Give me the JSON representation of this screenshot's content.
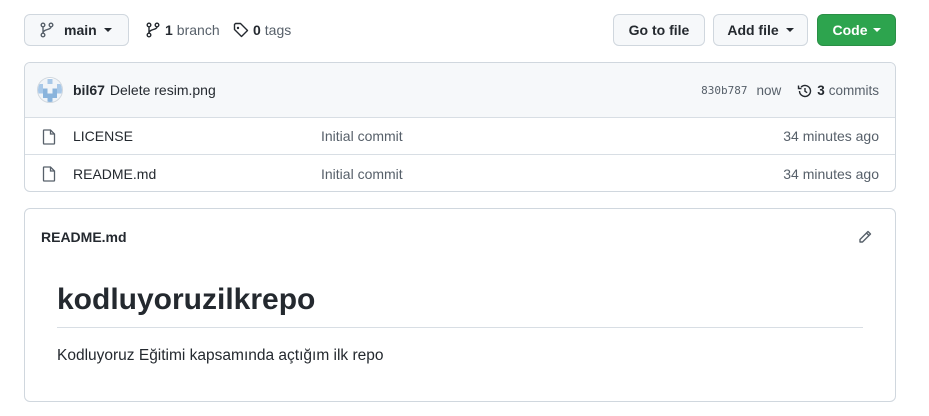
{
  "toolbar": {
    "branch_name": "main",
    "branch_count": "1",
    "branch_label": "branch",
    "tag_count": "0",
    "tag_label": "tags",
    "go_to_file": "Go to file",
    "add_file": "Add file",
    "code": "Code"
  },
  "commit": {
    "author": "bil67",
    "message": "Delete resim.png",
    "sha": "830b787",
    "time": "now",
    "commit_count": "3",
    "commit_label": "commits"
  },
  "files": [
    {
      "name": "LICENSE",
      "message": "Initial commit",
      "age": "34 minutes ago",
      "icon": "file-icon"
    },
    {
      "name": "README.md",
      "message": "Initial commit",
      "age": "34 minutes ago",
      "icon": "file-icon"
    }
  ],
  "readme": {
    "filename": "README.md",
    "heading": "kodluyoruzilkrepo",
    "body": "Kodluyoruz Eğitimi kapsamında açtığım ilk repo"
  },
  "colors": {
    "accent_green": "#2da44e",
    "border": "#d0d7de",
    "muted_text": "#57606a"
  }
}
